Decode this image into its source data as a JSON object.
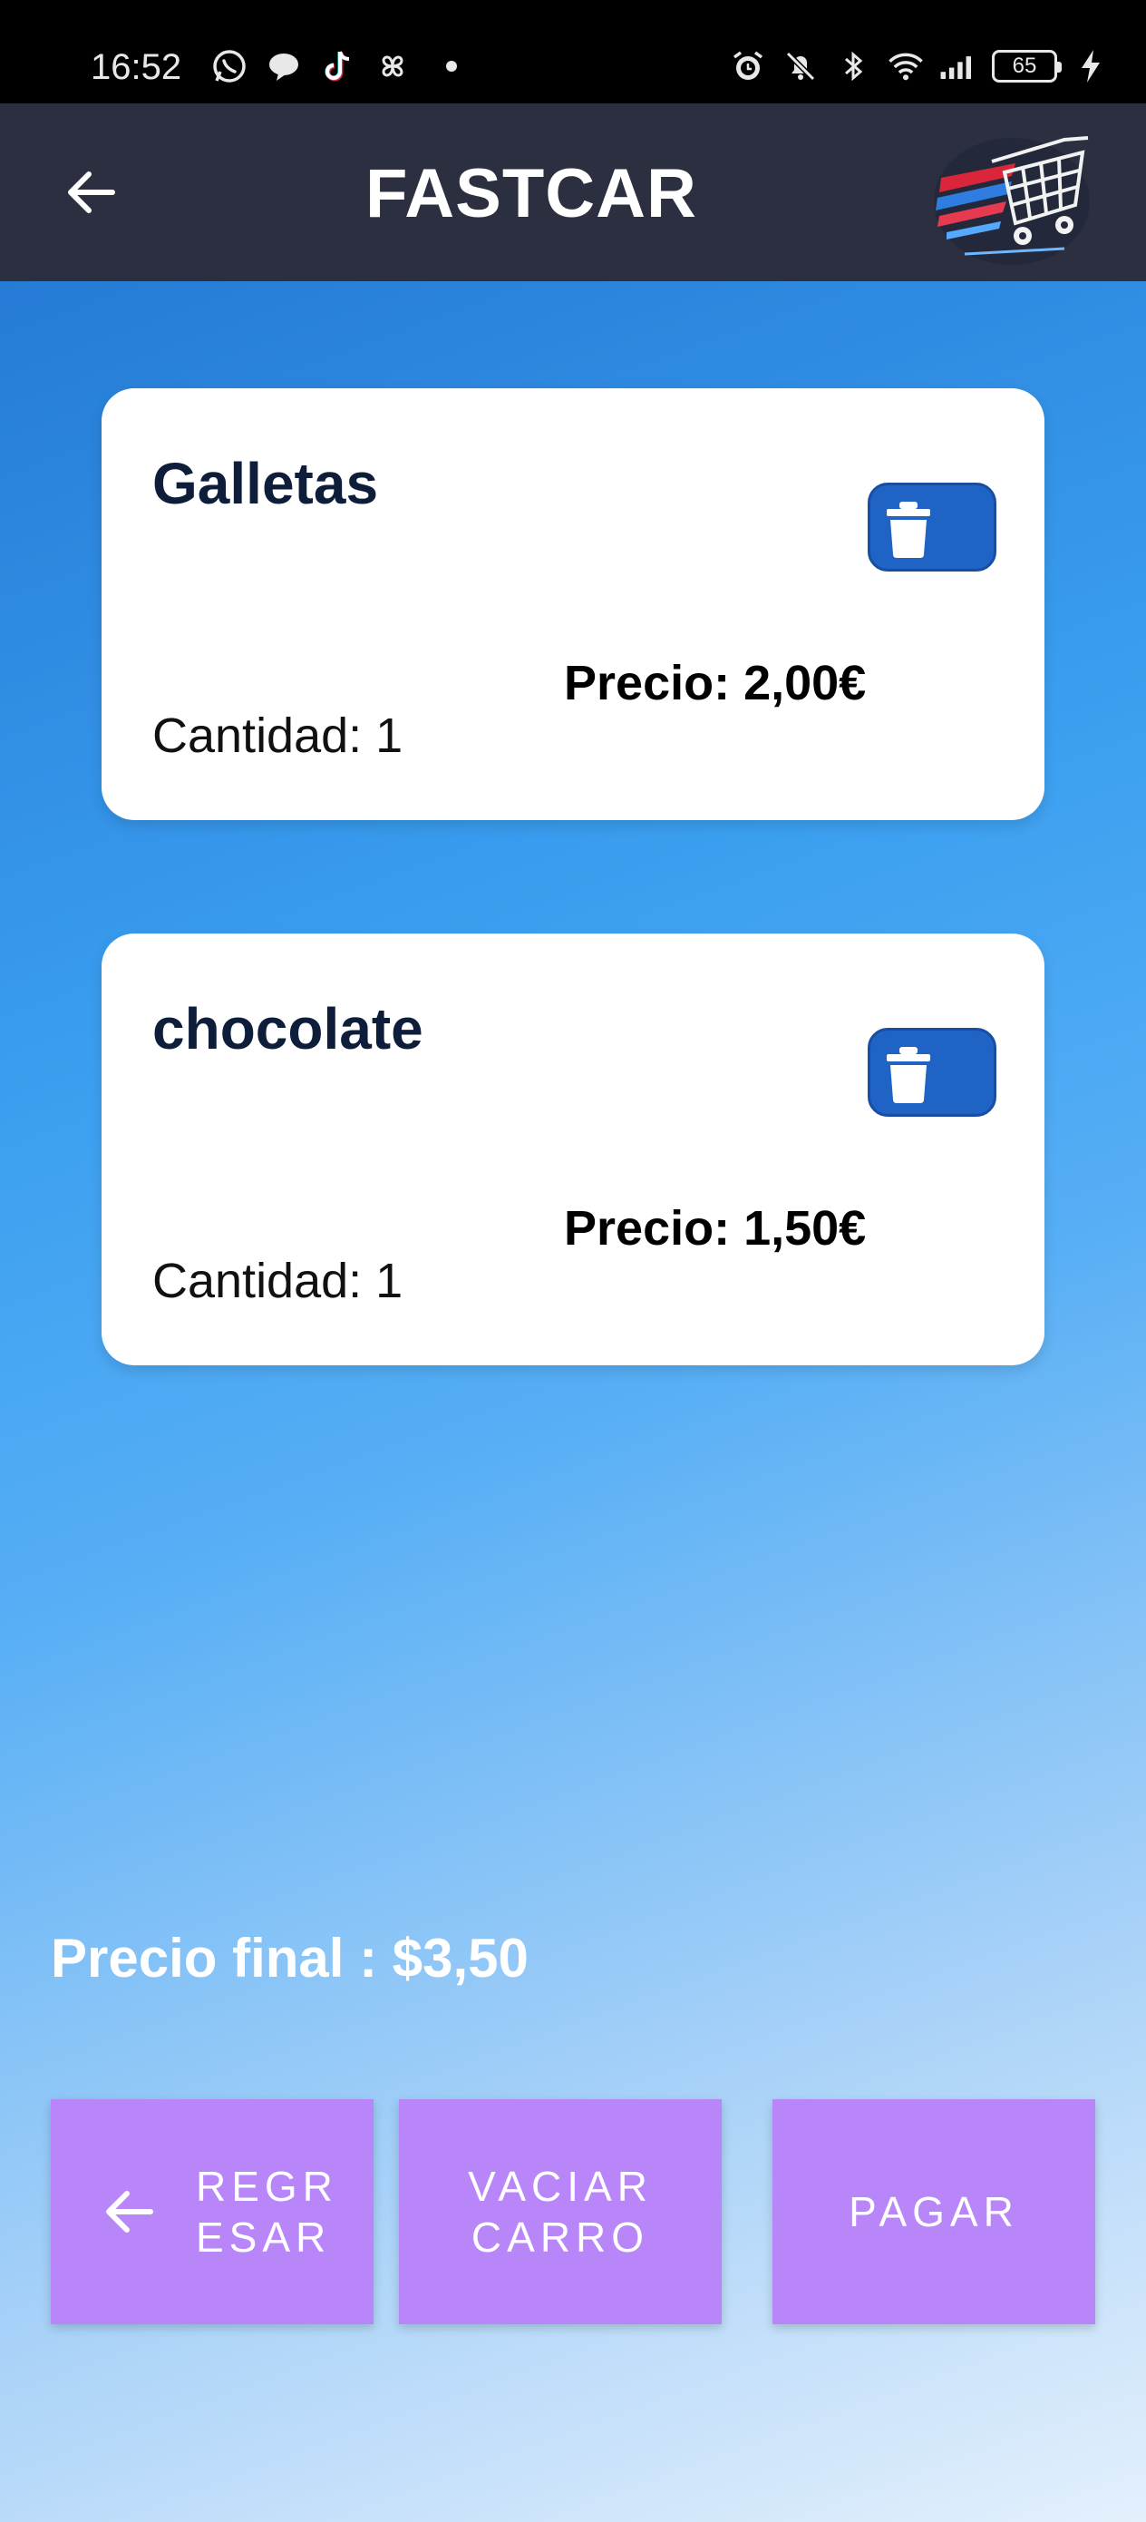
{
  "status_bar": {
    "time": "16:52",
    "battery": "65",
    "left_icons": [
      "whatsapp-icon",
      "chat-bubble-icon",
      "tiktok-icon",
      "pinwheel-icon"
    ],
    "right_icons": [
      "alarm-icon",
      "bell-muted-icon",
      "bluetooth-icon",
      "wifi-icon",
      "signal-icon",
      "charging-bolt-icon"
    ]
  },
  "app_bar": {
    "title": "FASTCAR",
    "back_icon": "arrow-left-icon",
    "logo": "shopping-cart-logo"
  },
  "cart": {
    "items": [
      {
        "name": "Galletas",
        "price": "Precio: 2,00€",
        "quantity": "Cantidad: 1"
      },
      {
        "name": "chocolate",
        "price": "Precio: 1,50€",
        "quantity": "Cantidad: 1"
      }
    ],
    "total": "Precio final : $3,50"
  },
  "actions": {
    "back_label": "REGR\nESAR",
    "empty_label": "VACIAR\nCARRO",
    "pay_label": "PAGAR"
  },
  "colors": {
    "app_bar": "#2b2f3f",
    "delete_button": "#1f63c4",
    "action_button": "#b886f8"
  }
}
